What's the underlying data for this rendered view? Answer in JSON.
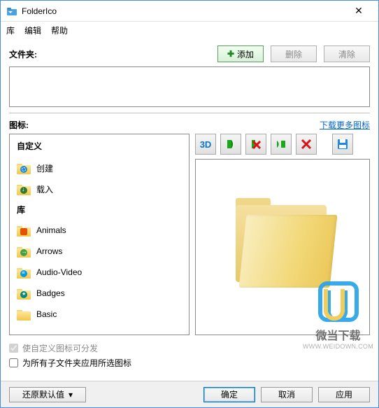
{
  "window": {
    "title": "FolderIco"
  },
  "menu": {
    "library": "库",
    "edit": "编辑",
    "help": "帮助"
  },
  "folders": {
    "label": "文件夹:",
    "add": "添加",
    "delete": "删除",
    "clear": "清除"
  },
  "icons": {
    "label": "图标:",
    "download_more": "下载更多图标"
  },
  "tree": {
    "custom_header": "自定义",
    "items_custom": [
      {
        "label": "创建",
        "overlay": "gear"
      },
      {
        "label": "载入",
        "overlay": "down"
      }
    ],
    "library_header": "库",
    "items_library": [
      {
        "label": "Animals",
        "overlay": "fox"
      },
      {
        "label": "Arrows",
        "overlay": "arrow"
      },
      {
        "label": "Audio-Video",
        "overlay": "audio"
      },
      {
        "label": "Badges",
        "overlay": "badge"
      },
      {
        "label": "Basic",
        "overlay": ""
      }
    ]
  },
  "toolbar": {
    "threeD": "3D"
  },
  "checks": {
    "distributable": "使自定义图标可分发",
    "apply_subfolders": "为所有子文件夹应用所选图标"
  },
  "bottom": {
    "restore": "还原默认值",
    "ok": "确定",
    "cancel": "取消",
    "apply": "应用"
  },
  "watermark": {
    "text": "微当下载",
    "url": "WWW.WEIDOWN.COM"
  }
}
